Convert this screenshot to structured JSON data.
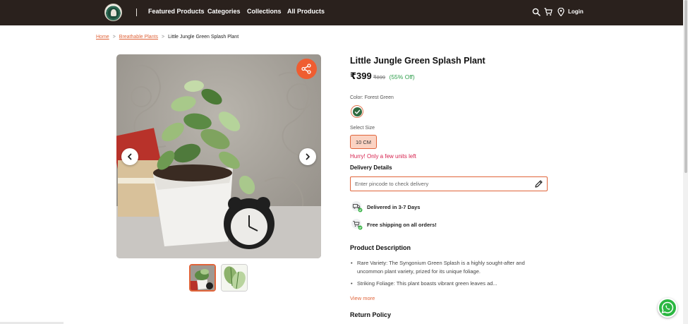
{
  "header": {
    "nav": [
      "Featured Products",
      "Categories",
      "Collections",
      "All Products"
    ],
    "login": "Login",
    "icons": [
      "search-icon",
      "cart-icon",
      "location-pin-icon"
    ]
  },
  "breadcrumb": {
    "home": "Home",
    "category": "Breathable Plants",
    "current": "Little Jungle Green Splash Plant"
  },
  "product": {
    "title": "Little Jungle Green Splash Plant",
    "price": "₹399",
    "mrp": "₹899",
    "discount": "(55% Off)",
    "color_label": "Color: Forest Green",
    "color_swatch": "#2f6b40",
    "size_label": "Select Size",
    "size_option": "10 CM",
    "stock_warning": "Hurry! Only a few units left",
    "delivery_title": "Delivery Details",
    "pincode_placeholder": "Enter pincode to check delivery",
    "delivery_time": "Delivered in 3-7 Days",
    "free_shipping": "Free shipping on all orders!",
    "description_title": "Product Description",
    "description_points": [
      "Rare Variety: The Syngonium Green Splash is a highly sought-after and uncommon plant variety, prized for its unique foliage.",
      "Striking Foliage: This plant boasts vibrant green leaves ad..."
    ],
    "view_more": "View more",
    "return_title": "Return Policy"
  },
  "colors": {
    "header_bg": "#2a211d",
    "accent": "#e0643a",
    "share_button": "#ef5d31",
    "discount": "#2e9e4b",
    "warning": "#d6224e",
    "whatsapp": "#2bb741"
  }
}
